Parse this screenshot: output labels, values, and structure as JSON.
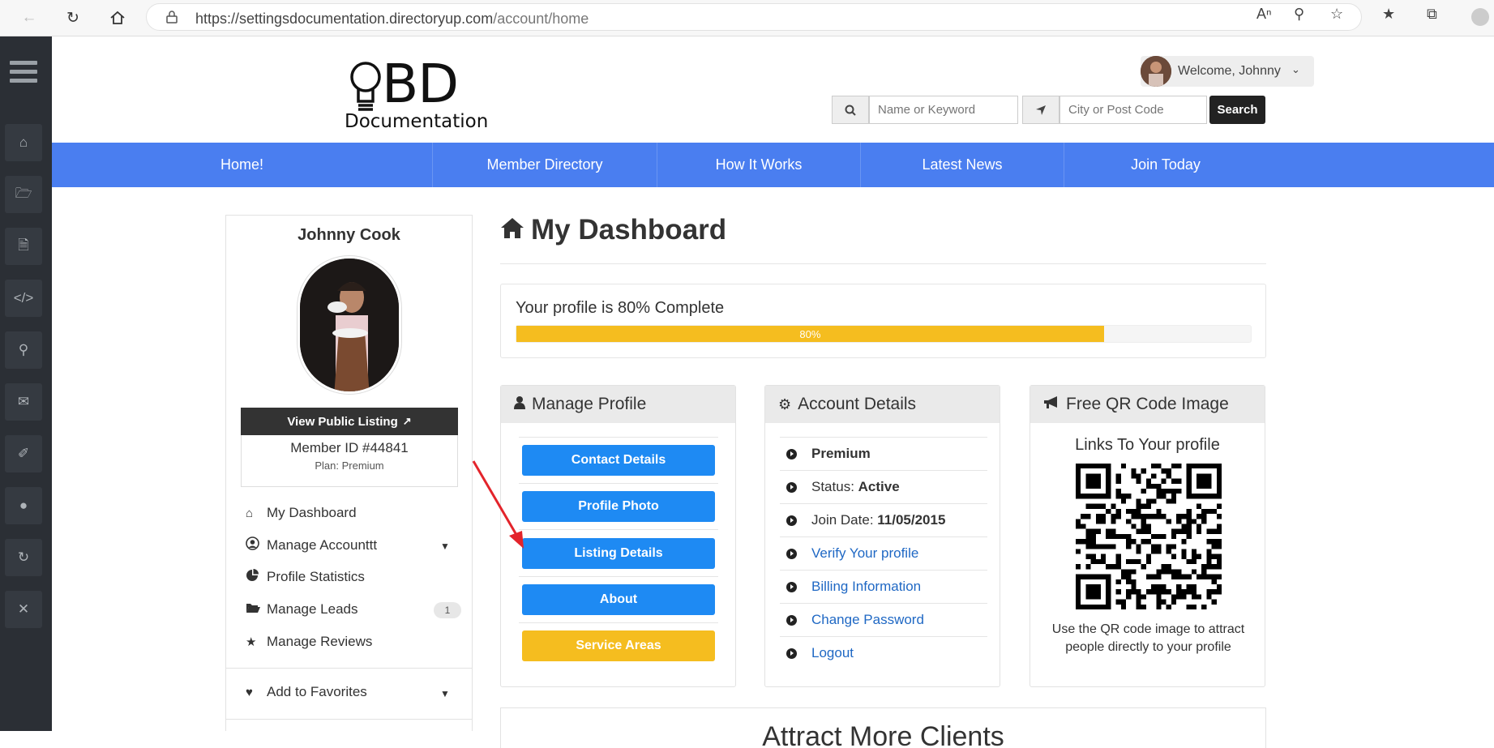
{
  "browser": {
    "url_host": "https://settingsdocumentation.directoryup.com",
    "url_path": "/account/home"
  },
  "header": {
    "logo_letters": "BD",
    "logo_word": "Documentation",
    "welcome": "Welcome, Johnny",
    "keyword_placeholder": "Name or Keyword",
    "location_placeholder": "City or Post Code",
    "search_label": "Search"
  },
  "nav": [
    "Home!",
    "Member Directory",
    "How It Works",
    "Latest News",
    "Join Today"
  ],
  "profile": {
    "name": "Johnny Cook",
    "view_public": "View Public Listing",
    "member_id": "Member ID #44841",
    "plan": "Plan: Premium"
  },
  "left_menu": {
    "dashboard": "My Dashboard",
    "manage_account": "Manage Accounttt",
    "profile_stats": "Profile Statistics",
    "manage_leads": "Manage Leads",
    "leads_count": "1",
    "manage_reviews": "Manage Reviews",
    "favorites": "Add to Favorites"
  },
  "dashboard": {
    "title": "My Dashboard",
    "progress_text": "Your profile is 80% Complete",
    "progress_percent": 80,
    "progress_label": "80%"
  },
  "manage_profile": {
    "title": "Manage Profile",
    "buttons": [
      "Contact Details",
      "Profile Photo",
      "Listing Details",
      "About",
      "Service Areas"
    ]
  },
  "account_details": {
    "title": "Account Details",
    "plan": "Premium",
    "status_label": "Status: ",
    "status_value": "Active",
    "join_label": "Join Date: ",
    "join_value": "11/05/2015",
    "links": [
      "Verify Your profile",
      "Billing Information",
      "Change Password",
      "Logout"
    ]
  },
  "qr": {
    "title": "Free QR Code Image",
    "subtitle": "Links To Your profile",
    "caption_1": "Use the QR code image to attract",
    "caption_2": "people directly to your profile"
  },
  "bottom": {
    "heading": "Attract More Clients"
  },
  "colors": {
    "nav_blue": "#4a7ef0",
    "button_blue": "#1e8af3",
    "accent_yellow": "#f5bd1f",
    "sidebar_dark": "#2b2f35"
  }
}
